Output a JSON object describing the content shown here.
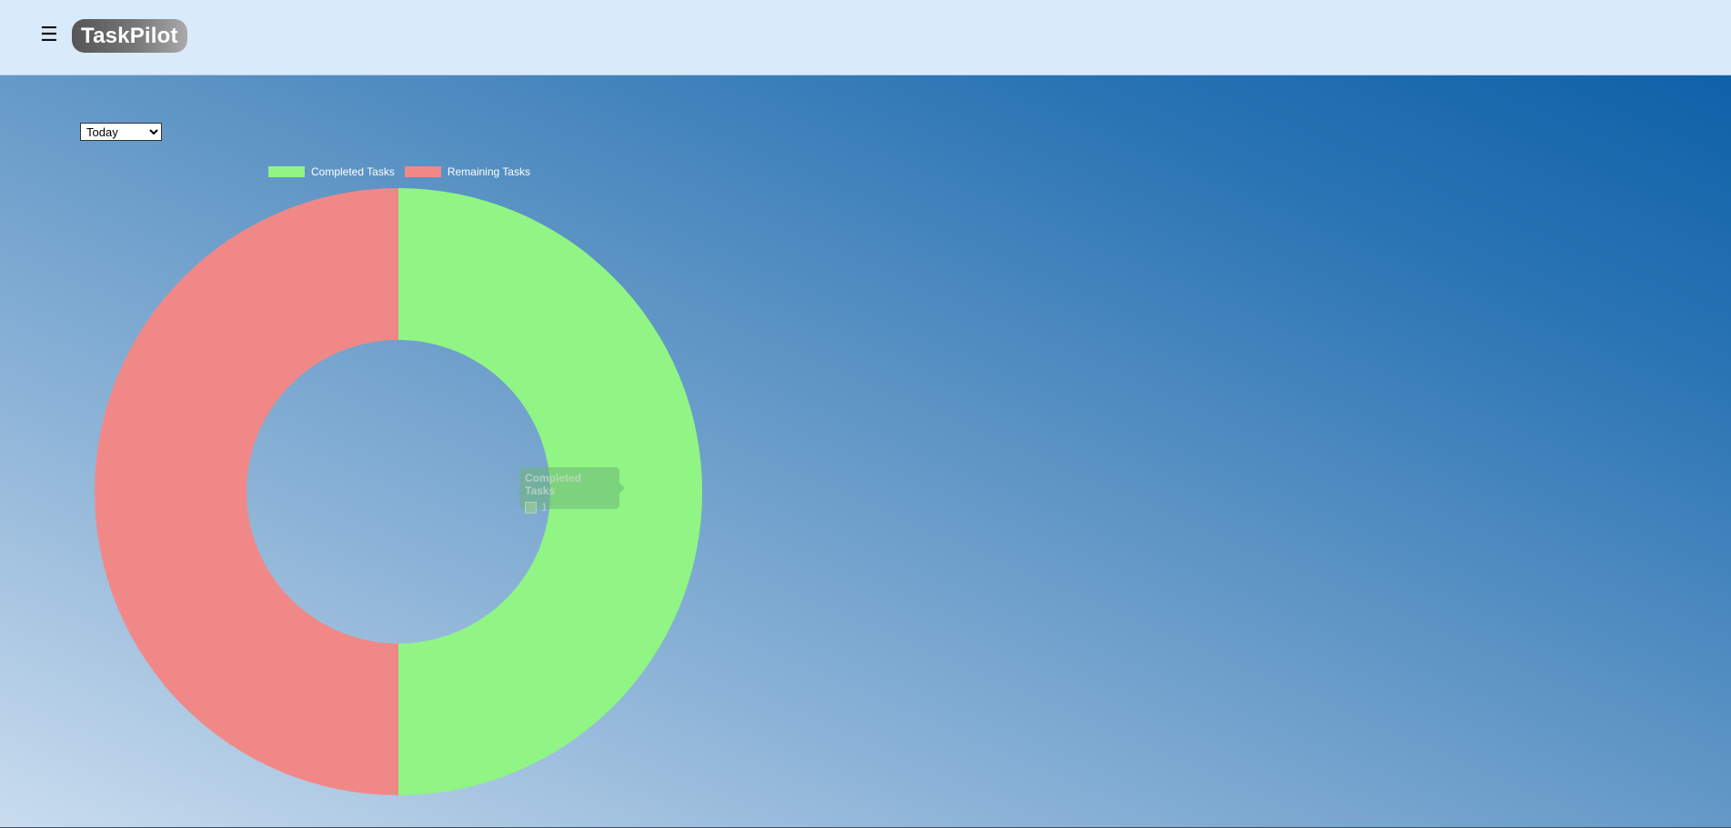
{
  "header": {
    "menu_icon": "☰",
    "logo_text": "TaskPilot"
  },
  "filter": {
    "selected": "Today"
  },
  "colors": {
    "completed": "#90f584",
    "remaining": "#f18888"
  },
  "chart_data": {
    "type": "pie",
    "variant": "doughnut",
    "labels": [
      "Completed Tasks",
      "Remaining Tasks"
    ],
    "values": [
      1,
      1
    ],
    "legend_position": "top"
  },
  "tooltip": {
    "title": "Completed Tasks",
    "value": "1"
  }
}
